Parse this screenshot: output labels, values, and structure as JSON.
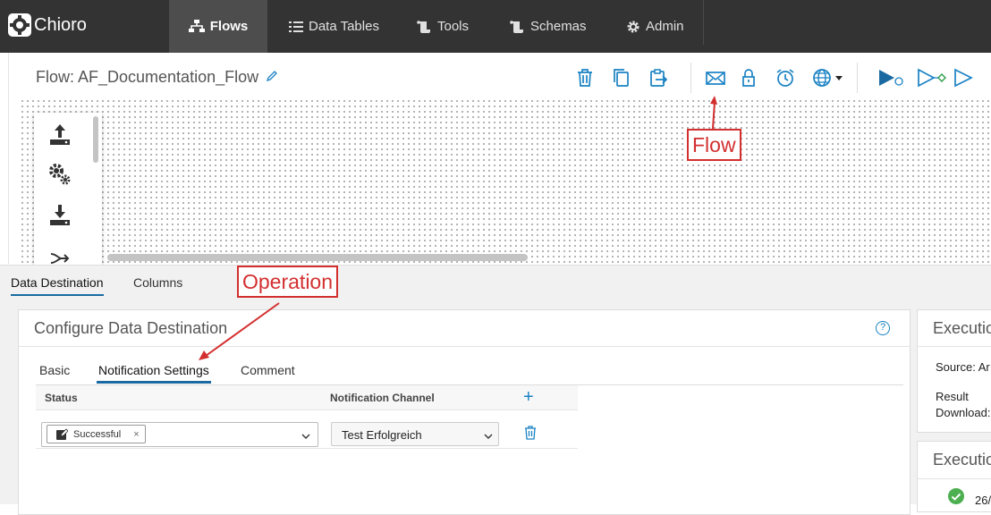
{
  "app": {
    "name": "Chioro"
  },
  "nav": {
    "items": [
      {
        "label": "Flows",
        "icon": "sitemap-icon",
        "active": true
      },
      {
        "label": "Data Tables",
        "icon": "list-icon",
        "active": false
      },
      {
        "label": "Tools",
        "icon": "scroll-icon",
        "active": false
      },
      {
        "label": "Schemas",
        "icon": "scroll-icon",
        "active": false
      },
      {
        "label": "Admin",
        "icon": "gear-icon",
        "active": false
      }
    ]
  },
  "flow": {
    "title": "Flow: AF_Documentation_Flow"
  },
  "toolbar": {
    "icons": [
      "trash-icon",
      "copy-icon",
      "export-icon",
      "mail-icon",
      "lock-icon",
      "alarm-clock-icon",
      "globe-icon",
      "run-icon",
      "run-debug-icon",
      "play-icon"
    ]
  },
  "palette": {
    "icons": [
      "upload-icon",
      "gears-icon",
      "download-icon",
      "merge-icon"
    ]
  },
  "annotations": {
    "flow": "Flow",
    "operation": "Operation"
  },
  "tabs": {
    "items": [
      "Data Destination",
      "Columns"
    ],
    "active": "Data Destination"
  },
  "configure": {
    "title": "Configure Data Destination",
    "subtabs": [
      "Basic",
      "Notification Settings",
      "Comment"
    ],
    "active_subtab": "Notification Settings",
    "table": {
      "headers": {
        "status": "Status",
        "channel": "Notification Channel"
      },
      "rows": [
        {
          "status_chip": "Successful",
          "channel": "Test Erfolgreich"
        }
      ]
    }
  },
  "right_panel": {
    "panel1": {
      "title": "Execution",
      "source_label": "Source:",
      "source_value": "Ar",
      "result_label": "Result",
      "download_label": "Download:"
    },
    "panel2": {
      "title": "Execution",
      "entry_date": "26/"
    }
  },
  "colors": {
    "accent": "#1a82c4",
    "nav_bg": "#333333",
    "annotation": "#d32f2f",
    "success": "#4caf50"
  }
}
